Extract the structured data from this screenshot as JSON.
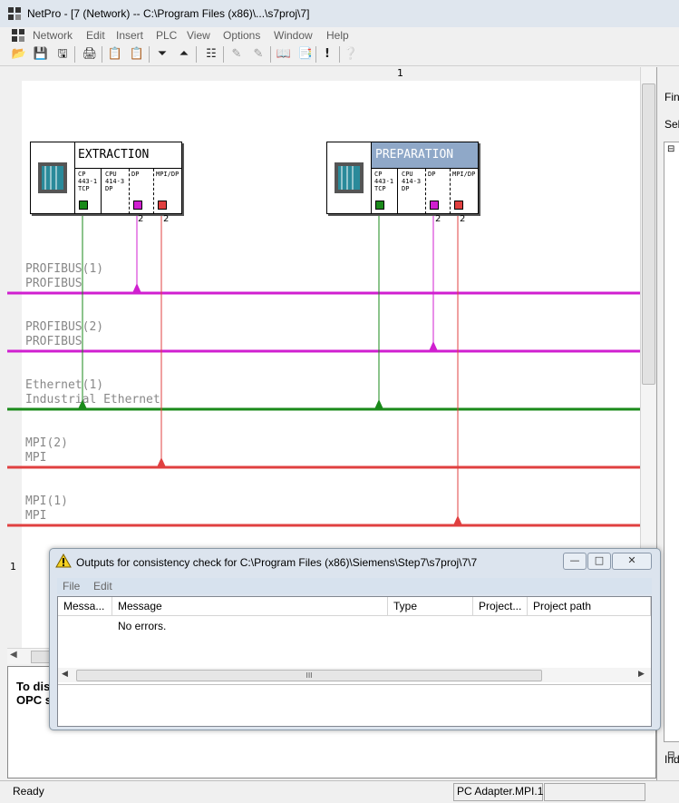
{
  "window": {
    "title": "NetPro - [7 (Network) -- C:\\Program Files (x86)\\...\\s7proj\\7]"
  },
  "menu": [
    "Network",
    "Edit",
    "Insert",
    "PLC",
    "View",
    "Options",
    "Window",
    "Help"
  ],
  "ruler": {
    "column_label": "1",
    "row_label": "1"
  },
  "stations": [
    {
      "name": "EXTRACTION",
      "modules": [
        {
          "label": "CP\n443-1\nTCP"
        },
        {
          "label": "CPU\n414-3\nDP"
        },
        {
          "label": "DP"
        },
        {
          "label": "MPI/DP"
        }
      ],
      "port_numbers": [
        "2",
        "2"
      ],
      "selected": false
    },
    {
      "name": "PREPARATION",
      "modules": [
        {
          "label": "CP\n443-1\nTCP"
        },
        {
          "label": "CPU\n414-3\nDP"
        },
        {
          "label": "DP"
        },
        {
          "label": "MPI/DP"
        }
      ],
      "port_numbers": [
        "2",
        "2"
      ],
      "selected": true
    }
  ],
  "networks": [
    {
      "name": "PROFIBUS(1)",
      "type": "PROFIBUS",
      "color": "#d01fd0"
    },
    {
      "name": "PROFIBUS(2)",
      "type": "PROFIBUS",
      "color": "#d01fd0"
    },
    {
      "name": "Ethernet(1)",
      "type": "Industrial Ethernet",
      "color": "#1a8a1a"
    },
    {
      "name": "MPI(2)",
      "type": "MPI",
      "color": "#e04040"
    },
    {
      "name": "MPI(1)",
      "type": "MPI",
      "color": "#e04040"
    }
  ],
  "bottom_panel": {
    "line1": "To dis",
    "line2": "OPC s"
  },
  "right_panel": {
    "find": "Find",
    "select": "Sele",
    "index": "Ind"
  },
  "dialog": {
    "title": "Outputs for consistency check for  C:\\Program Files (x86)\\Siemens\\Step7\\s7proj\\7\\7",
    "menu": [
      "File",
      "Edit"
    ],
    "columns": [
      "Messa...",
      "Message",
      "Type",
      "Project...",
      "Project path"
    ],
    "rows": [
      {
        "message": "No errors."
      }
    ],
    "scroll_marker": "III"
  },
  "statusbar": {
    "status": "Ready",
    "adapter": "PC Adapter.MPI.1"
  }
}
